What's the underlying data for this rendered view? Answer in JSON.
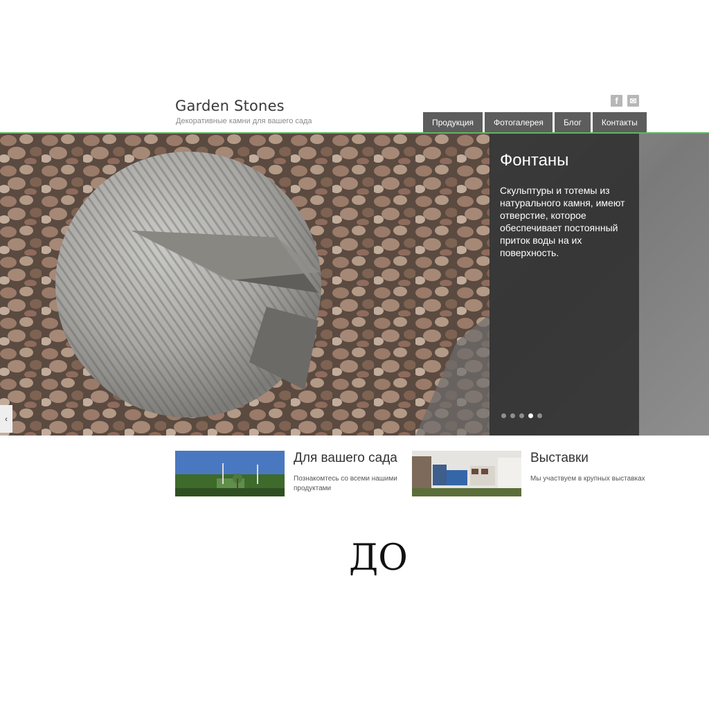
{
  "header": {
    "site_title": "Garden Stones",
    "tagline": "Декоративные камни для вашего сада",
    "social": [
      {
        "icon": "facebook-icon",
        "glyph": "f"
      },
      {
        "icon": "mail-icon",
        "glyph": "✉"
      }
    ]
  },
  "nav": {
    "items": [
      {
        "label": "Продукция"
      },
      {
        "label": "Фотогалерея"
      },
      {
        "label": "Блог"
      },
      {
        "label": "Контакты"
      }
    ]
  },
  "slider": {
    "title": "Фонтаны",
    "text": "Скульптуры и тотемы из натурального камня, имеют отверстие, которое обеспечивает постоянный приток воды на их поверхность.",
    "prev_glyph": "‹",
    "slide_count": 5,
    "active_slide": 4
  },
  "cards": [
    {
      "title": "Для вашего сада",
      "text": "Познакомтесь со всеми нашими продуктами"
    },
    {
      "title": "Выставки",
      "text": "Мы участвуем в крупных выставках"
    }
  ],
  "label": "ДО",
  "colors": {
    "nav_bg": "#5d5d5d",
    "accent_rule": "#5cb85c",
    "caption_bg": "rgba(40,40,40,0.82)"
  }
}
